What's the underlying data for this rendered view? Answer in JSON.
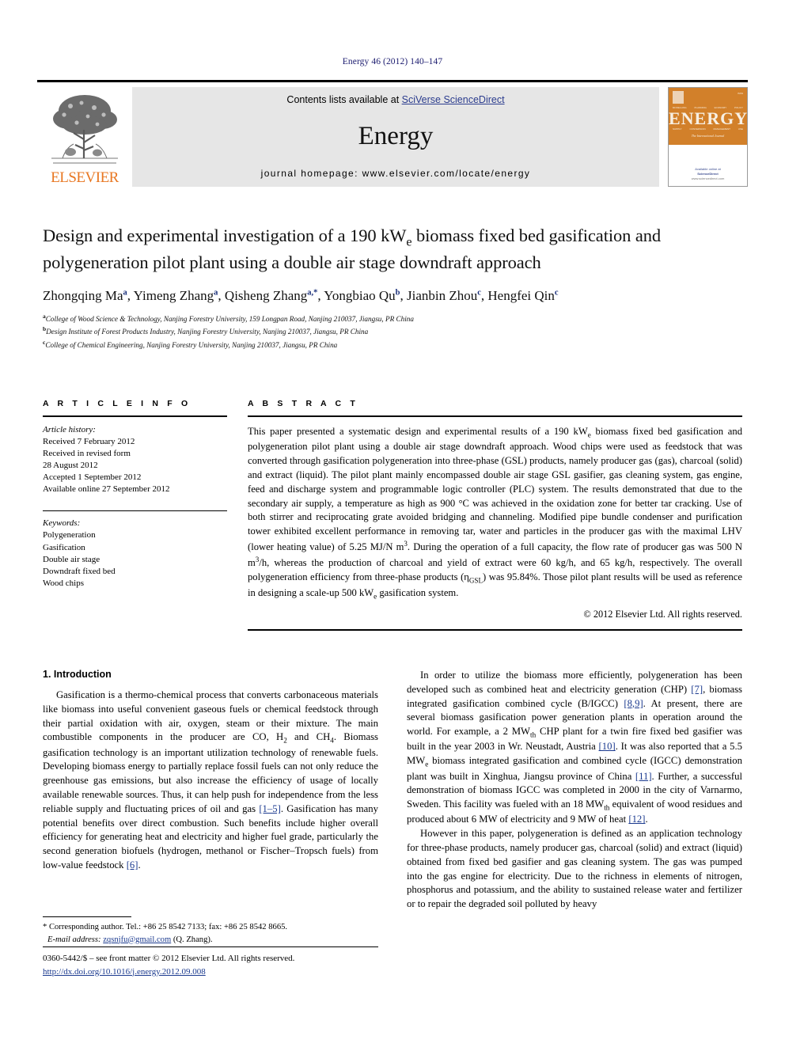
{
  "running_head": "Energy 46 (2012) 140–147",
  "masthead": {
    "contents_prefix": "Contents lists available at ",
    "contents_link": "SciVerse ScienceDirect",
    "journal_name": "Energy",
    "homepage": "journal homepage: www.elsevier.com/locate/energy",
    "publisher": "ELSEVIER",
    "cover": {
      "word": "ENERGY",
      "subtitle": "The International Journal",
      "science_direct": "Available online at",
      "science_direct_name": "ScienceDirect",
      "science_direct_url": "www.sciencedirect.com"
    }
  },
  "article": {
    "title_line1": "Design and experimental investigation of a 190 kW",
    "title_sub1": "e",
    "title_line1b": " biomass fixed bed",
    "title_line2": "gasification and polygeneration pilot plant using a double air stage",
    "title_line3": "downdraft approach",
    "authors": [
      {
        "name": "Zhongqing Ma",
        "marks": "a"
      },
      {
        "name": "Yimeng Zhang",
        "marks": "a"
      },
      {
        "name": "Qisheng Zhang",
        "marks": "a,*"
      },
      {
        "name": "Yongbiao Qu",
        "marks": "b"
      },
      {
        "name": "Jianbin Zhou",
        "marks": "c"
      },
      {
        "name": "Hengfei Qin",
        "marks": "c"
      }
    ],
    "affiliations": [
      {
        "mark": "a",
        "text": "College of Wood Science & Technology, Nanjing Forestry University, 159 Longpan Road, Nanjing 210037, Jiangsu, PR China"
      },
      {
        "mark": "b",
        "text": "Design Institute of Forest Products Industry, Nanjing Forestry University, Nanjing 210037, Jiangsu, PR China"
      },
      {
        "mark": "c",
        "text": "College of Chemical Engineering, Nanjing Forestry University, Nanjing 210037, Jiangsu, PR China"
      }
    ]
  },
  "article_info": {
    "heading": "A R T I C L E  I N F O",
    "history_label": "Article history:",
    "history": [
      "Received 7 February 2012",
      "Received in revised form",
      "28 August 2012",
      "Accepted 1 September 2012",
      "Available online 27 September 2012"
    ],
    "keywords_label": "Keywords:",
    "keywords": [
      "Polygeneration",
      "Gasification",
      "Double air stage",
      "Downdraft fixed bed",
      "Wood chips"
    ]
  },
  "abstract": {
    "heading": "A B S T R A C T",
    "p1_a": "This paper presented a systematic design and experimental results of a 190 kW",
    "p1_sub": "e",
    "p1_b": " biomass fixed bed gasification and polygeneration pilot plant using a double air stage downdraft approach. Wood chips were used as feedstock that was converted through gasification polygeneration into three-phase (GSL) products, namely producer gas (gas), charcoal (solid) and extract (liquid). The pilot plant mainly encompassed double air stage GSL gasifier, gas cleaning system, gas engine, feed and discharge system and programmable logic controller (PLC) system. The results demonstrated that due to the secondary air supply, a temperature as high as 900 °C was achieved in the oxidation zone for better tar cracking. Use of both stirrer and reciprocating grate avoided bridging and channeling. Modified pipe bundle condenser and purification tower exhibited excellent performance in removing tar, water and particles in the producer gas with the maximal LHV (lower heating value) of 5.25 MJ/N m",
    "p1_sup1": "3",
    "p1_c": ". During the operation of a full capacity, the flow rate of producer gas was 500 N m",
    "p1_sup2": "3",
    "p1_d": "/h, whereas the production of charcoal and yield of extract were 60 kg/h, and 65 kg/h, respectively. The overall polygeneration efficiency from three-phase products (η",
    "p1_sub2": "GSL",
    "p1_e": ") was 95.84%. Those pilot plant results will be used as reference in designing a scale-up 500 kW",
    "p1_sub3": "e",
    "p1_f": " gasification system.",
    "copyright": "© 2012 Elsevier Ltd. All rights reserved."
  },
  "introduction": {
    "section_number_title": "1. Introduction",
    "left_p1_a": "Gasification is a thermo-chemical process that converts carbonaceous materials like biomass into useful convenient gaseous fuels or chemical feedstock through their partial oxidation with air, oxygen, steam or their mixture. The main combustible components in the producer are CO, H",
    "left_p1_sub1": "2",
    "left_p1_b": " and CH",
    "left_p1_sub2": "4",
    "left_p1_c": ". Biomass gasification technology is an important utilization technology of renewable fuels. Developing biomass energy to partially replace fossil fuels can not only reduce the greenhouse gas emissions, but also increase the efficiency of usage of locally available renewable sources. Thus, it can help push for independence from the less reliable supply and fluctuating prices of oil and gas ",
    "left_p1_ref1": "[1–5]",
    "left_p1_d": ". Gasification has many potential benefits over direct combustion. Such benefits include higher overall efficiency for generating heat and electricity and higher fuel grade, particularly the second generation biofuels (hydrogen, methanol or Fischer–Tropsch fuels) from low-value feedstock ",
    "left_p1_ref2": "[6]",
    "left_p1_e": ".",
    "right_p1_a": "In order to utilize the biomass more efficiently, polygeneration has been developed such as combined heat and electricity generation (CHP) ",
    "right_p1_ref1": "[7]",
    "right_p1_b": ", biomass integrated gasification combined cycle (B/IGCC) ",
    "right_p1_ref2": "[8,9]",
    "right_p1_c": ". At present, there are several biomass gasification power generation plants in operation around the world. For example, a 2 MW",
    "right_p1_sub1": "th",
    "right_p1_d": " CHP plant for a twin fire fixed bed gasifier was built in the year 2003 in Wr. Neustadt, Austria ",
    "right_p1_ref3": "[10]",
    "right_p1_e": ". It was also reported that a 5.5 MW",
    "right_p1_sub2": "e",
    "right_p1_f": " biomass integrated gasification and combined cycle (IGCC) demonstration plant was built in Xinghua, Jiangsu province of China ",
    "right_p1_ref4": "[11]",
    "right_p1_g": ". Further, a successful demonstration of biomass IGCC was completed in 2000 in the city of Varnarmo, Sweden. This facility was fueled with an 18 MW",
    "right_p1_sub3": "th",
    "right_p1_h": " equivalent of wood residues and produced about 6 MW of electricity and 9 MW of heat ",
    "right_p1_ref5": "[12]",
    "right_p1_i": ".",
    "right_p2": "However in this paper, polygeneration is defined as an application technology for three-phase products, namely producer gas, charcoal (solid) and extract (liquid) obtained from fixed bed gasifier and gas cleaning system. The gas was pumped into the gas engine for electricity. Due to the richness in elements of nitrogen, phosphorus and potassium, and the ability to sustained release water and fertilizer or to repair the degraded soil polluted by heavy"
  },
  "footnote": {
    "star": "*",
    "line1": " Corresponding author. Tel.: +86 25 8542 7133; fax: +86 25 8542 8665.",
    "email_label": "E-mail address:",
    "email": "zqsnjfu@gmail.com",
    "email_suffix": " (Q. Zhang)."
  },
  "footer": {
    "issn": "0360-5442/$ – see front matter © 2012 Elsevier Ltd. All rights reserved.",
    "doi": "http://dx.doi.org/10.1016/j.energy.2012.09.008"
  },
  "colors": {
    "elsevier_orange": "#E87722",
    "link_blue": "#1b3a8f",
    "mast_grey": "#e6e6e6",
    "cover_orange": "#d2802a"
  }
}
